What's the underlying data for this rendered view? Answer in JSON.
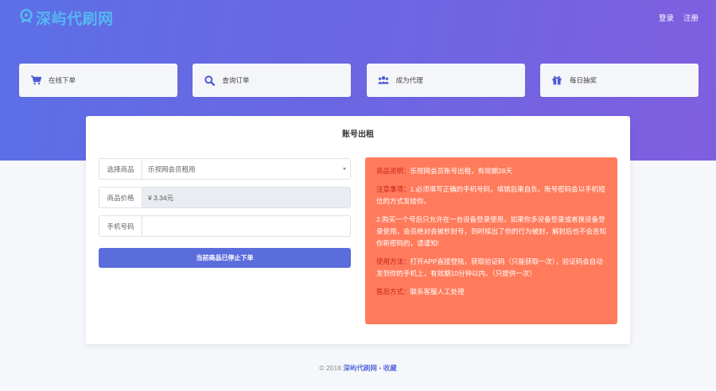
{
  "brand": {
    "name": "深屿代刷网"
  },
  "nav": {
    "login": "登录",
    "register": "注册"
  },
  "quick": [
    {
      "label": "在线下单",
      "icon": "cart-icon"
    },
    {
      "label": "查询订单",
      "icon": "search-icon"
    },
    {
      "label": "成为代理",
      "icon": "users-icon"
    },
    {
      "label": "每日抽奖",
      "icon": "gift-icon"
    }
  ],
  "panel": {
    "title": "账号出租"
  },
  "form": {
    "product_label": "选择商品",
    "product_value": "乐视网会员租用",
    "price_label": "商品价格",
    "price_value": "¥ 3.34元",
    "phone_label": "手机号码",
    "phone_placeholder": "",
    "submit": "当前商品已停止下单"
  },
  "notice": {
    "p1_key": "商品说明：",
    "p1_text": "乐视网会员账号出租，有效期28天",
    "p2_key": "注意事项：",
    "p2_text": "1.必须填写正确的手机号码，填错后果自负。账号密码会以手机短信的方式发给你。",
    "p3_text": "2.购买一个号后只允许在一台设备登录使用，如果你多设备登录或者换设备登录使用，会员绝对会被秒封号，到时候出了你的行为被封，解封后也不会告知你新密码的，请谨知!",
    "p4_key": "使用方法：",
    "p4_text": "打开APP直接登陆，获取验证码（只能获取一次），验证码会自动发到你的手机上，有效期10分钟以内。（只提供一次）",
    "p5_key": "售后方式：",
    "p5_text": "联系客服人工处理"
  },
  "footer": {
    "copyright": "© 2018",
    "site": "深屿代刷网",
    "sep": "•",
    "bookmark": "收藏"
  },
  "colors": {
    "accent": "#5b6cdd",
    "notice_bg": "#ff7b5c",
    "logo": "#55b8f2"
  }
}
